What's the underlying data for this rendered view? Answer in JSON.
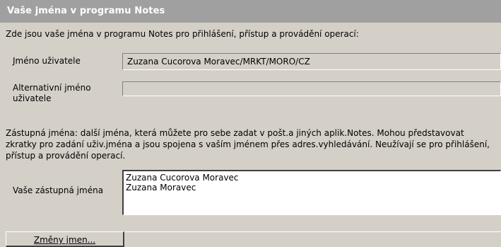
{
  "header": {
    "title": "Vaše jména v programu Notes"
  },
  "intro_text": "Zde jsou vaše jména v programu Notes pro přihlášení, přístup a provádění operací:",
  "user_name": {
    "label": "Jméno uživatele",
    "value": "Zuzana Cucorova Moravec/MRKT/MORO/CZ"
  },
  "alternate_name": {
    "label_line1": "Alternativní jméno",
    "label_line2": "uživatele",
    "value": ""
  },
  "aliases_description": "Zástupná jména: další jména, která můžete pro sebe zadat v pošt.a jiných aplik.Notes. Mohou představovat zkratky pro zadání uživ.jména a jsou spojena s vaším jménem přes adres.vyhledávání. Neužívají se pro přihlášení, přístup a provádění operací.",
  "aliases": {
    "label": "Vaše zástupná jména",
    "items": [
      "Zuzana Cucorova Moravec",
      "Zuzana Moravec"
    ]
  },
  "change_names_button": {
    "label": "Změny jmen..."
  }
}
